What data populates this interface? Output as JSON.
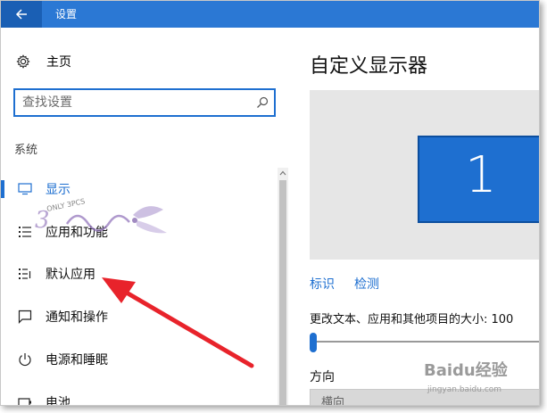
{
  "window": {
    "title": "设置",
    "accent_color": "#2b78d4"
  },
  "sidebar": {
    "home_label": "主页",
    "search_placeholder": "查找设置",
    "section_label": "系统",
    "items": [
      {
        "label": "显示",
        "icon": "monitor-icon",
        "active": true
      },
      {
        "label": "应用和功能",
        "icon": "apps-list-icon",
        "active": false
      },
      {
        "label": "默认应用",
        "icon": "default-apps-icon",
        "active": false
      },
      {
        "label": "通知和操作",
        "icon": "notification-icon",
        "active": false
      },
      {
        "label": "电源和睡眠",
        "icon": "power-icon",
        "active": false
      },
      {
        "label": "电池",
        "icon": "battery-icon",
        "active": false
      }
    ]
  },
  "main": {
    "title": "自定义显示器",
    "monitor_number": "1",
    "identify_link": "标识",
    "detect_link": "检测",
    "scale_label": "更改文本、应用和其他项目的大小: 100",
    "scale_slider_value": 0,
    "orientation_label": "方向",
    "orientation_value": "横向"
  },
  "watermarks": {
    "logo_text": "ONLY 3PCS",
    "baidu_text": "Baidu经验",
    "baidu_url": "jingyan.baidu.com"
  },
  "annotation": {
    "arrow_color": "#e8232b"
  }
}
